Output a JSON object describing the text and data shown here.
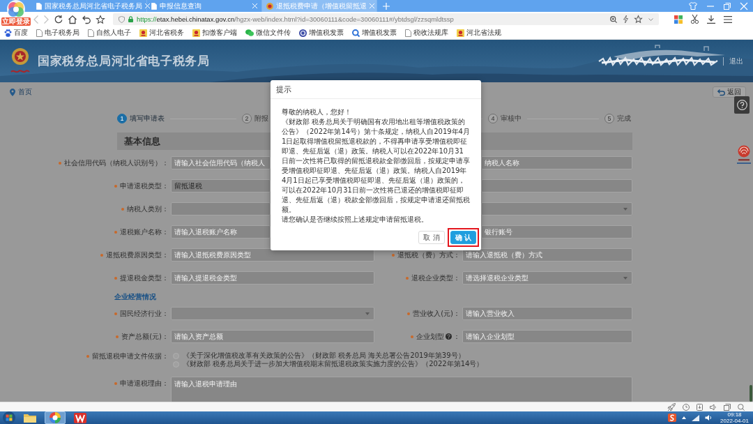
{
  "browser": {
    "login_badge": "立即登录",
    "tabs": [
      {
        "title": "国家税务总局河北省电子税务局",
        "selected": false,
        "kind": "page"
      },
      {
        "title": "申报信息查询",
        "selected": false,
        "kind": "page"
      },
      {
        "title": "退抵税费申请（增值税留抵退",
        "selected": true,
        "kind": "emblem"
      }
    ],
    "back": {
      "disabled": true
    },
    "forward": {
      "disabled": true
    },
    "address": {
      "scheme": "https://",
      "host": "etax.hebei.chinatax.gov.cn",
      "path": "/hgzx-web/index.html?id=30060111&code=30060111#/ybtdsgl/zzsqmldtssp"
    },
    "bookmarks": [
      {
        "label": "百度",
        "kind": "paw"
      },
      {
        "label": "电子税务局",
        "kind": "page"
      },
      {
        "label": "自然人电子",
        "kind": "page"
      },
      {
        "label": "河北省税务",
        "kind": "emblem"
      },
      {
        "label": "扣缴客户端",
        "kind": "emblem"
      },
      {
        "label": "微信文件传",
        "kind": "chat"
      },
      {
        "label": "增值税发票",
        "kind": "disc"
      },
      {
        "label": "增值税发票",
        "kind": "search"
      },
      {
        "label": "税收法规库",
        "kind": "page"
      },
      {
        "label": "河北省法规",
        "kind": "emblem"
      }
    ]
  },
  "header": {
    "title": "国家税务总局河北省电子税务局",
    "logout": "退出"
  },
  "breadcrumb": {
    "home": "首页",
    "back": "返回"
  },
  "steps": [
    {
      "number": "1",
      "label": "填写申请表",
      "active": true
    },
    {
      "number": "2",
      "label": "附报",
      "active": false
    },
    {
      "number": "4",
      "label": "审核中",
      "active": false
    },
    {
      "number": "5",
      "label": "完成",
      "active": false
    }
  ],
  "form": {
    "section_title": "基本信息",
    "basic_rows": [
      {
        "left": {
          "label": "社会信用代码（纳税人识别号）：",
          "required": true,
          "kind": "input",
          "placeholder": "请输入社会信用代码（纳税人"
        },
        "right": {
          "kind": "input",
          "placeholder": "纳税人名称"
        }
      },
      {
        "left": {
          "label": "申请退税类型：",
          "required": true,
          "kind": "input",
          "value": "留抵退税"
        },
        "right": {
          "kind": "input"
        }
      },
      {
        "left": {
          "label": "纳税人类别：",
          "required": true,
          "kind": "select"
        },
        "right": {
          "kind": "select"
        }
      },
      {
        "left": {
          "label": "退税账户名称：",
          "required": true,
          "kind": "input",
          "placeholder": "请输入退税账户名称"
        },
        "right": {
          "kind": "input",
          "placeholder": "银行账号"
        }
      },
      {
        "left": {
          "label": "退抵税费原因类型：",
          "required": true,
          "kind": "input",
          "placeholder": "请输入退抵税费原因类型"
        },
        "right": {
          "label": "退抵税（费）方式：",
          "required": true,
          "kind": "input",
          "placeholder": "请输入退抵税（费）方式"
        }
      },
      {
        "left": {
          "label": "提退税金类型：",
          "required": true,
          "kind": "input",
          "placeholder": "请输入提退税金类型"
        },
        "right": {
          "label": "退税企业类型：",
          "required": true,
          "kind": "select",
          "placeholder": "请选择退税企业类型"
        }
      }
    ],
    "subsection_title": "企业经营情况",
    "business_rows": [
      {
        "left": {
          "label": "国民经济行业：",
          "required": true,
          "kind": "select"
        },
        "right": {
          "label": "营业收入(元)：",
          "required": true,
          "kind": "input",
          "placeholder": "请输入营业收入"
        }
      },
      {
        "left": {
          "label": "资产总额(元)：",
          "required": true,
          "kind": "input",
          "placeholder": "请输入资产总额"
        },
        "right": {
          "label": "企业划型",
          "label_end": "：",
          "help": true,
          "required": true,
          "kind": "input",
          "placeholder": "请输入企业划型"
        }
      }
    ],
    "basis": {
      "label": "留抵退税申请文件依据：",
      "required": true,
      "options": [
        {
          "text": "《关于深化增值税改革有关政策的公告》（财政部 税务总局 海关总署公告2019年第39号）",
          "selected": false
        },
        {
          "text": "《财政部 税务总局关于进一步加大增值税期末留抵退税政策实施力度的公告》（2022年第14号）",
          "selected": false
        }
      ]
    },
    "reason": {
      "label": "申请退税理由：",
      "required": true,
      "placeholder": "请输入退税申请理由"
    }
  },
  "dialog": {
    "title": "提示",
    "paragraphs": [
      "尊敬的纳税人，您好！",
      "《财政部 税务总局关于明确国有农用地出租等增值税政策的公告》（2022年第14号）第十条规定，纳税人自2019年4月1日起取得增值税留抵退税款的，不得再申请享受增值税即征即退、先征后返（退）政策。纳税人可以在2022年10月31日前一次性将已取得的留抵退税款全部缴回后，按规定申请享受增值税即征即退、先征后返（退）政策。纳税人自2019年4月1日起已享受增值税即征即退、先征后返（退）政策的，可以在2022年10月31日前一次性将已退还的增值税即征即退、先征后返（退）税款全部缴回后，按规定申请退还留抵税额。",
      "请您确认是否继续按照上述规定申请留抵退税。"
    ],
    "buttons": [
      {
        "label": "取 消",
        "kind": "secondary",
        "highlighted": false
      },
      {
        "label": "确 认",
        "kind": "primary",
        "highlighted": true
      }
    ]
  },
  "taskbar": {
    "apps": [
      {
        "kind": "explorer",
        "selected": false
      },
      {
        "kind": "browser",
        "selected": true
      },
      {
        "kind": "wps",
        "selected": false
      }
    ],
    "time": "09:18",
    "date": "2022-04-01"
  }
}
